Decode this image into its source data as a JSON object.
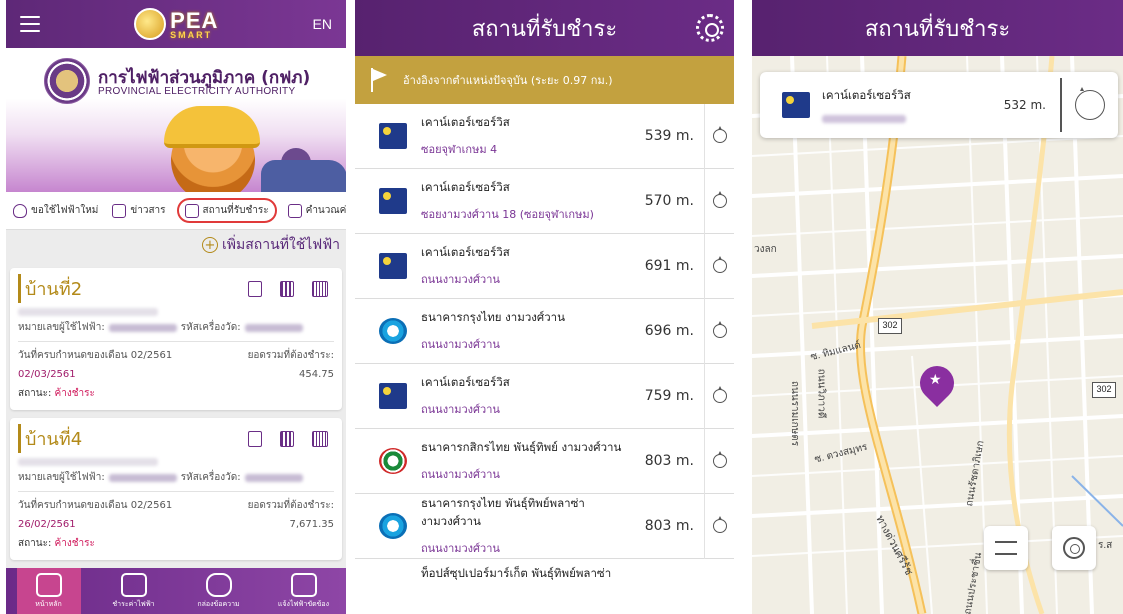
{
  "panel1": {
    "lang": "EN",
    "logo_text": "PEA",
    "logo_sub": "SMART",
    "authority_th": "การไฟฟ้าส่วนภูมิภาค (กฟภ)",
    "authority_en": "PROVINCIAL ELECTRICITY AUTHORITY",
    "menu": [
      "ขอใช้ไฟฟ้าใหม่",
      "ข่าวสาร",
      "สถานที่รับชำระ",
      "คำนวณค่าไฟฟ้า"
    ],
    "add_place": "เพิ่มสถานที่ใช้ไฟฟ้า",
    "cards": [
      {
        "title": "บ้านที่2",
        "user_label": "หมายเลขผู้ใช้ไฟฟ้า:",
        "meter_label": "รหัสเครื่องวัด:",
        "due_label": "วันที่ครบกำหนดของเดือน 02/2561",
        "total_label": "ยอดรวมที่ต้องชำระ:",
        "due_date": "02/03/2561",
        "amount": "454.75",
        "status_label": "สถานะ:",
        "status_value": "ค้างชำระ"
      },
      {
        "title": "บ้านที่4",
        "user_label": "หมายเลขผู้ใช้ไฟฟ้า:",
        "meter_label": "รหัสเครื่องวัด:",
        "due_label": "วันที่ครบกำหนดของเดือน 02/2561",
        "total_label": "ยอดรวมที่ต้องชำระ:",
        "due_date": "26/02/2561",
        "amount": "7,671.35",
        "status_label": "สถานะ:",
        "status_value": "ค้างชำระ"
      }
    ],
    "nav": [
      "หน้าหลัก",
      "ชำระค่าไฟฟ้า",
      "กล่องข้อความ",
      "แจ้งไฟฟ้าขัดข้อง"
    ]
  },
  "panel2": {
    "title": "สถานที่รับชำระ",
    "reference": "อ้างอิงจากตำแหน่งปัจจุบัน (ระยะ 0.97 กม.)",
    "items": [
      {
        "logo": "cs",
        "name": "เคาน์เตอร์เซอร์วิส",
        "sub": "ซอยจุฬาเกษม 4",
        "dist": "539 m."
      },
      {
        "logo": "cs",
        "name": "เคาน์เตอร์เซอร์วิส",
        "sub": "ซอยงามวงศ์วาน 18 (ซอยจุฬาเกษม)",
        "dist": "570 m."
      },
      {
        "logo": "cs",
        "name": "เคาน์เตอร์เซอร์วิส",
        "sub": "ถนนงามวงศ์วาน",
        "dist": "691 m."
      },
      {
        "logo": "ktb",
        "name": "ธนาคารกรุงไทย งามวงศ์วาน",
        "sub": "ถนนงามวงศ์วาน",
        "dist": "696 m."
      },
      {
        "logo": "cs",
        "name": "เคาน์เตอร์เซอร์วิส",
        "sub": "ถนนงามวงศ์วาน",
        "dist": "759 m."
      },
      {
        "logo": "kbank",
        "name": "ธนาคารกสิกรไทย พันธุ์ทิพย์ งามวงศ์วาน",
        "sub": "ถนนงามวงศ์วาน",
        "dist": "803 m."
      },
      {
        "logo": "ktb",
        "name": "ธนาคารกรุงไทย พันธุ์ทิพย์พลาซ่า งามวงศ์วาน",
        "sub": "ถนนงามวงศ์วาน",
        "dist": "803 m."
      }
    ],
    "last_item": "ท็อปส์ซุปเปอร์มาร์เก็ต พันธุ์ทิพย์พลาซ่า"
  },
  "panel3": {
    "title": "สถานที่รับชำระ",
    "card_name": "เคาน์เตอร์เซอร์วิส",
    "card_dist": "532 m.",
    "labels": {
      "road_302a": "302",
      "road_302b": "302",
      "left_edge": "วงลก",
      "soi1": "ซ. ทิมแลนด์",
      "soi2": "ซ. ตวงสมุทร",
      "road_vert1": "ถนนรามเกษตร",
      "road_vert2": "ถนนวิภาวดี",
      "expressway": "ทางด่วนศรีรัช",
      "road_vert3": "ถนนรัชดาภิเษก",
      "road_vert4": "ถนนประชาชื่น",
      "right_edge": "ร.ส"
    }
  }
}
